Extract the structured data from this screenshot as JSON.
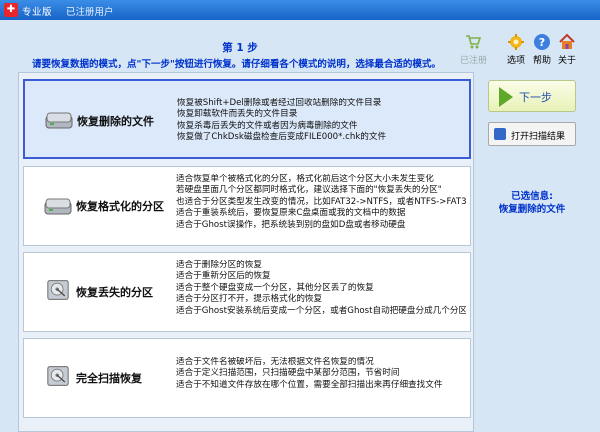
{
  "window": {
    "title": "专业版",
    "subtitle": "已注册用户"
  },
  "header": {
    "step": "第 1 步",
    "instruction": "请要恢复数据的模式，点\"下一步\"按钮进行恢复。请仔细看各个模式的说明，选择最合适的模式。"
  },
  "toolbar": {
    "registered_label": "已注册",
    "options_label": "选项",
    "help_label": "帮助",
    "about_label": "关于"
  },
  "modes": [
    {
      "name": "恢复删除的文件",
      "lines": [
        "恢复被Shift+Del删除或者经过回收站删除的文件目录",
        "恢复卸载软件而丢失的文件目录",
        "恢复杀毒后丢失的文件或者因为病毒删除的文件",
        "恢复做了ChkDsk磁盘检查后变成FILE000*.chk的文件"
      ]
    },
    {
      "name": "恢复格式化的分区",
      "lines": [
        "适合恢复单个被格式化的分区，格式化前后这个分区大小未发生变化",
        "若硬盘里面几个分区都同时格式化，建议选择下面的\"恢复丢失的分区\"",
        "也适合于分区类型发生改变的情况，比如FAT32->NTFS，或者NTFS->FAT32",
        "适合于重装系统后，要恢复原来C盘桌面或我的文档中的数据",
        "适合于Ghost误操作，把系统装到别的盘如D盘或者移动硬盘"
      ]
    },
    {
      "name": "恢复丢失的分区",
      "lines": [
        "适合于删除分区的恢复",
        "适合于重新分区后的恢复",
        "适合于整个硬盘变成一个分区，其他分区丢了的恢复",
        "适合于分区打不开，提示格式化的恢复",
        "适合于Ghost安装系统后变成一个分区，或者Ghost自动把硬盘分成几个分区"
      ]
    },
    {
      "name": "完全扫描恢复",
      "lines": [
        "适合于文件名被破坏后，无法根据文件名恢复的情况",
        "适合于定义扫描范围，只扫描硬盘中某部分范围，节省时间",
        "适合于不知道文件存放在哪个位置，需要全部扫描出来再仔细查找文件"
      ]
    }
  ],
  "actions": {
    "next_label": "下一步",
    "open_scan_label": "打开扫描结果"
  },
  "selection": {
    "title": "已选信息:",
    "value": "恢复删除的文件"
  },
  "colors": {
    "titlebar": "#1763c7",
    "accent_text": "#0033cc",
    "selected_border": "#3c5bd8"
  }
}
